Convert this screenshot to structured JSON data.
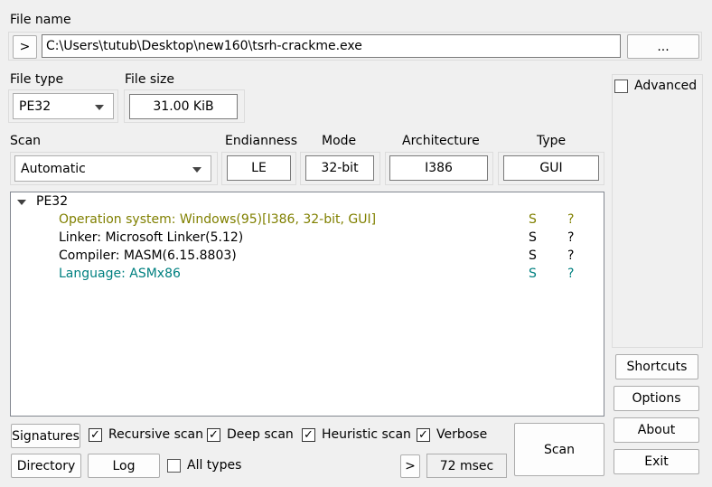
{
  "file": {
    "label": "File name",
    "path": "C:\\Users\\tutub\\Desktop\\new160\\tsrh-crackme.exe",
    "prev_button": ">",
    "browse_button": "..."
  },
  "filetype": {
    "label": "File type",
    "value": "PE32"
  },
  "filesize": {
    "label": "File size",
    "value": "31.00 KiB"
  },
  "scan": {
    "label": "Scan",
    "value": "Automatic"
  },
  "endianness": {
    "label": "Endianness",
    "value": "LE"
  },
  "mode": {
    "label": "Mode",
    "value": "32-bit"
  },
  "architecture": {
    "label": "Architecture",
    "value": "I386"
  },
  "type": {
    "label": "Type",
    "value": "GUI"
  },
  "tree": {
    "root": "PE32",
    "items": [
      {
        "text": "Operation system: Windows(95)[I386, 32-bit, GUI]",
        "s": "S",
        "q": "?",
        "color": "#808000"
      },
      {
        "text": "Linker: Microsoft Linker(5.12)",
        "s": "S",
        "q": "?",
        "color": "#000000"
      },
      {
        "text": "Compiler: MASM(6.15.8803)",
        "s": "S",
        "q": "?",
        "color": "#000000"
      },
      {
        "text": "Language: ASMx86",
        "s": "S",
        "q": "?",
        "color": "#008080"
      }
    ]
  },
  "advanced": {
    "label": "Advanced",
    "checked": false
  },
  "side_buttons": {
    "shortcuts": "Shortcuts",
    "options": "Options",
    "about": "About",
    "exit": "Exit"
  },
  "bottom": {
    "signatures": "Signatures",
    "recursive": {
      "label": "Recursive scan",
      "checked": true
    },
    "deep": {
      "label": "Deep scan",
      "checked": true
    },
    "heuristic": {
      "label": "Heuristic scan",
      "checked": true
    },
    "verbose": {
      "label": "Verbose",
      "checked": true
    },
    "directory": "Directory",
    "log": "Log",
    "alltypes": {
      "label": "All types",
      "checked": false
    },
    "more": ">",
    "time": "72 msec",
    "scan_button": "Scan"
  },
  "colors": {
    "background": "#f0f0f0",
    "os_detect": "#808000",
    "language_detect": "#008080"
  }
}
